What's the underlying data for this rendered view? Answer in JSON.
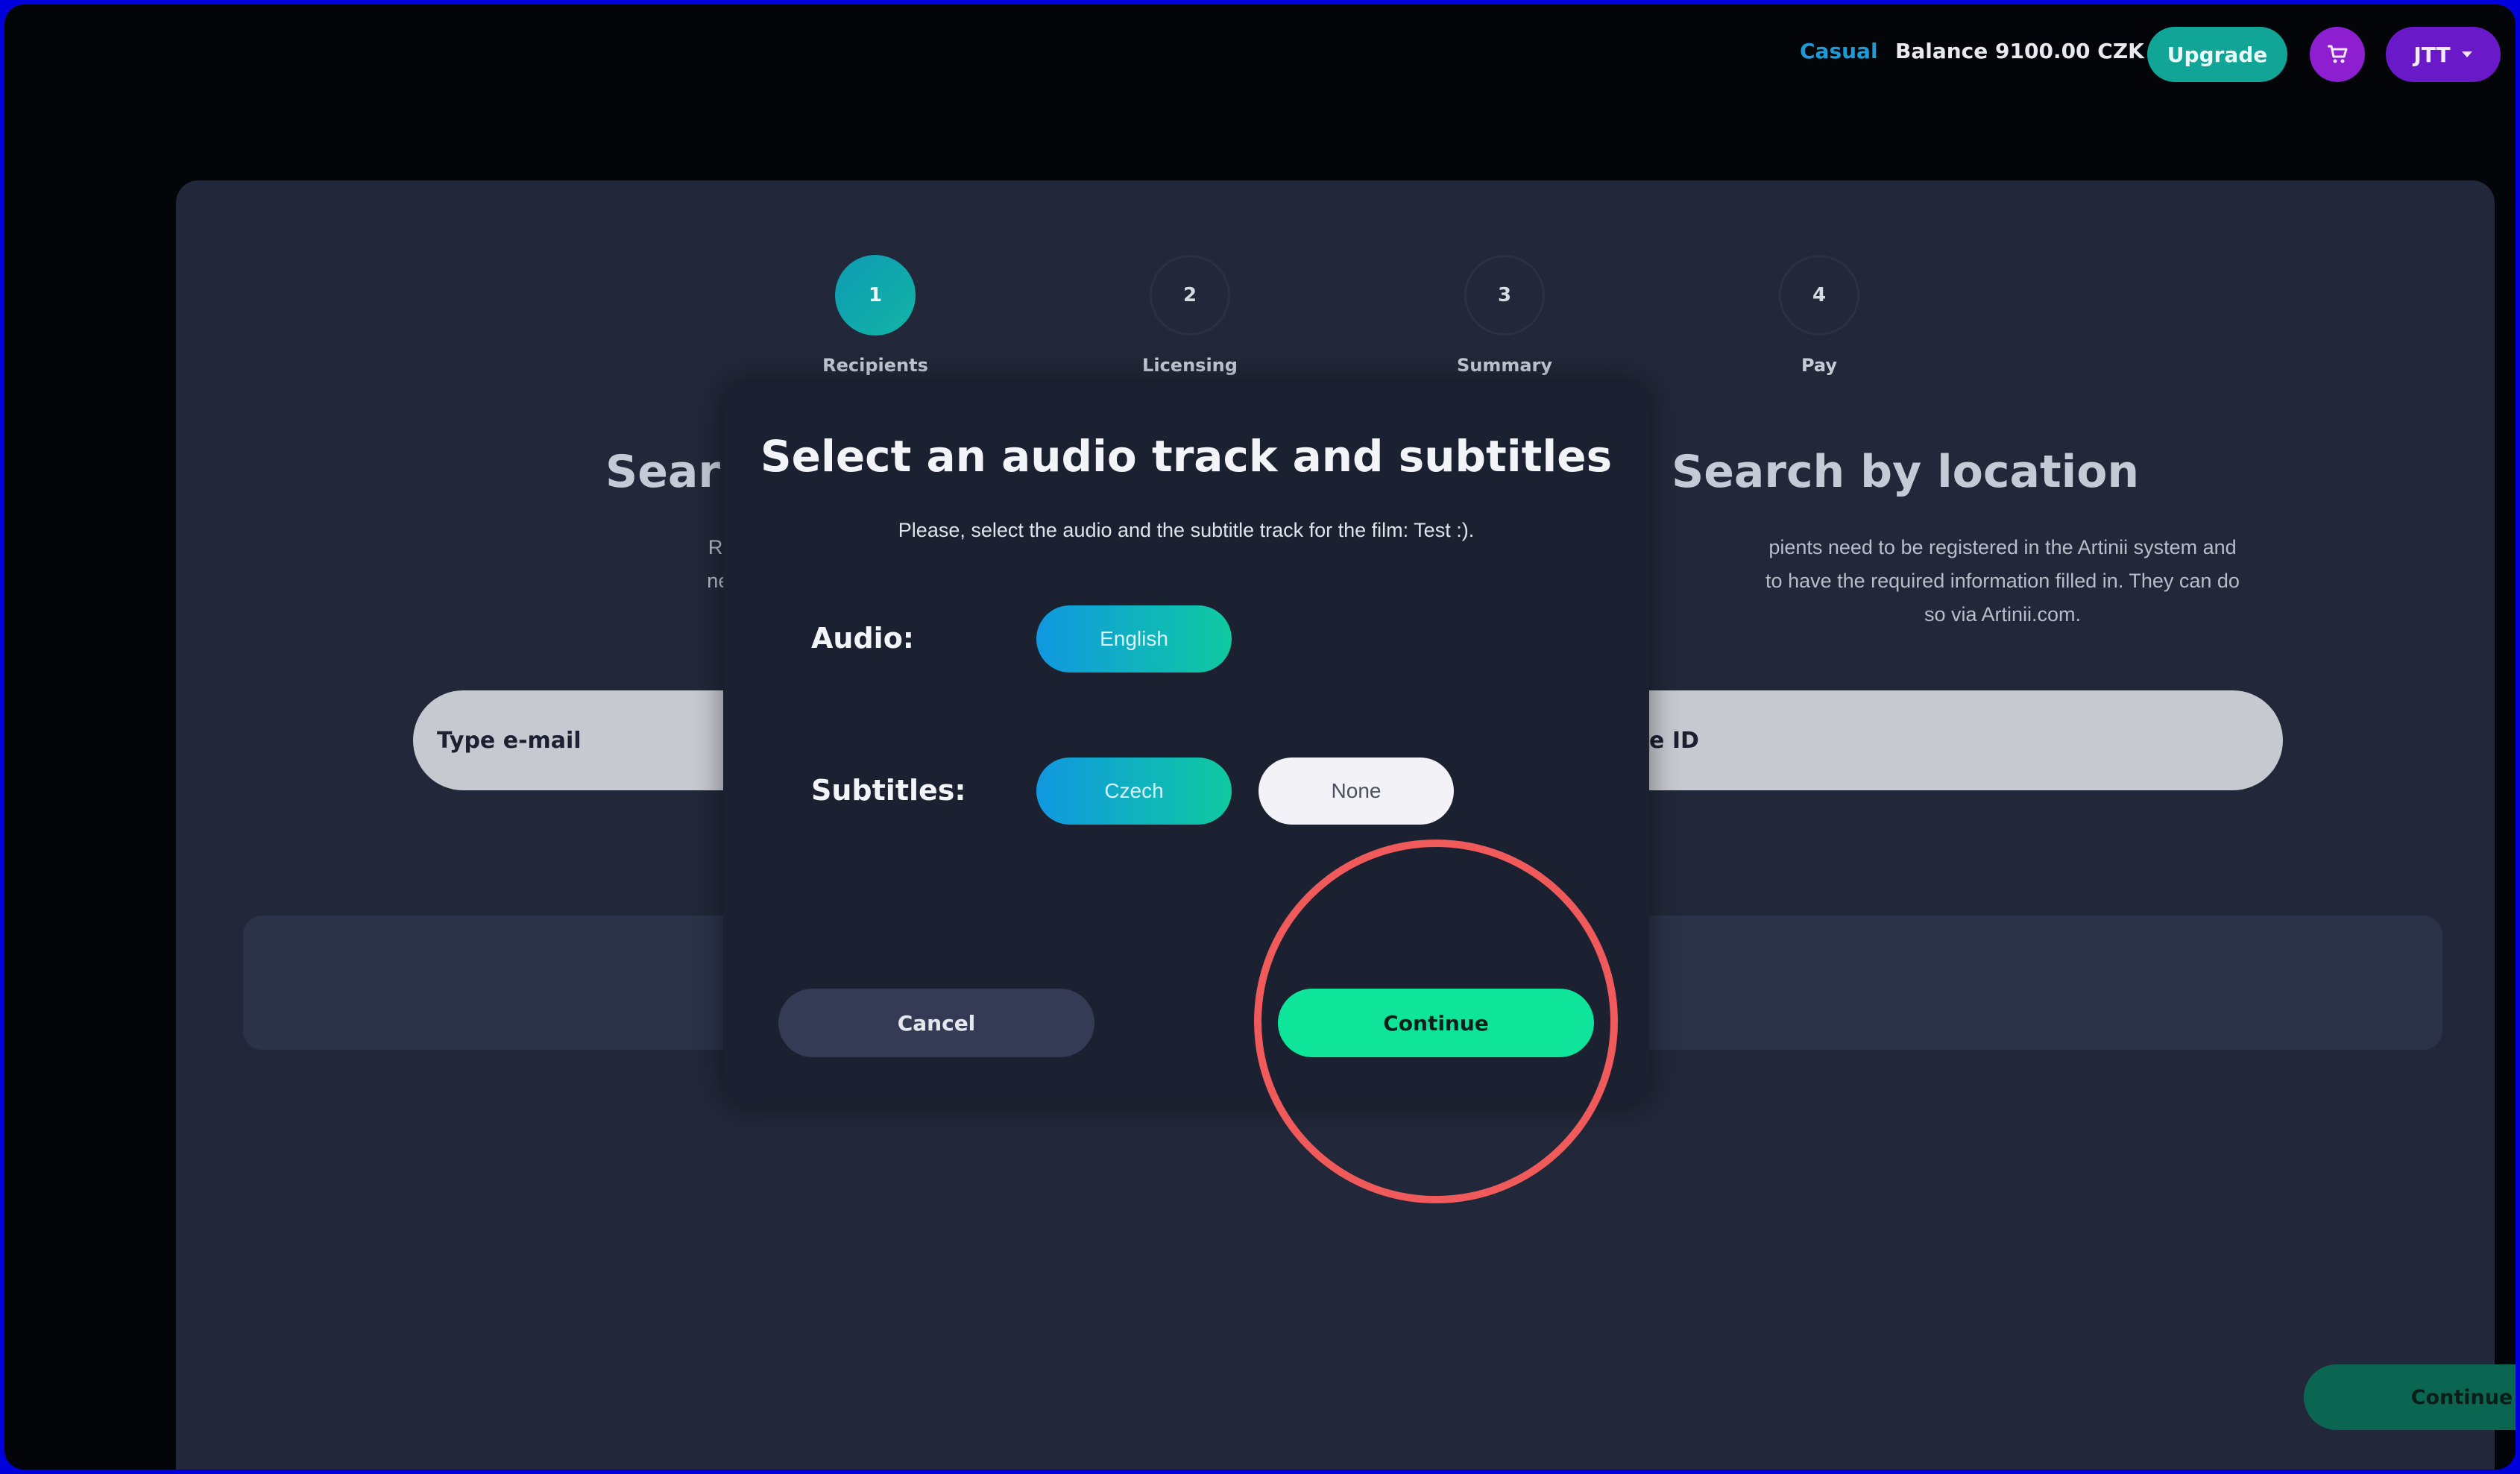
{
  "topbar": {
    "tier": "Casual",
    "balance": "Balance 9100.00 CZK",
    "upgrade_label": "Upgrade",
    "user_label": "JTT",
    "cart_icon": "cart-icon",
    "dropdown_icon": "caret-down-icon"
  },
  "steps": [
    {
      "number": "1",
      "label": "Recipients",
      "active": true
    },
    {
      "number": "2",
      "label": "Licensing",
      "active": false
    },
    {
      "number": "3",
      "label": "Summary",
      "active": false
    },
    {
      "number": "4",
      "label": "Pay",
      "active": false
    }
  ],
  "left_section": {
    "title": "Sear",
    "line1": "Recipients need to b",
    "line2": "need to have the req",
    "input_value": "Type e-mail"
  },
  "right_section": {
    "title": "Search by location",
    "line1": "pients need to be registered in the Artinii system and",
    "line2": "to have the required information filled in. They can do",
    "line3": "so via Artinii.com.",
    "input_value": "r place ID"
  },
  "background_continue_label": "Continue",
  "modal": {
    "title": "Select an audio track and subtitles",
    "description": "Please, select the audio and the subtitle track for the film: Test :).",
    "audio_label": "Audio:",
    "audio_options": [
      "English"
    ],
    "subtitles_label": "Subtitles:",
    "subtitle_options": [
      "Czech",
      "None"
    ],
    "cancel_label": "Cancel",
    "continue_label": "Continue"
  },
  "colors": {
    "accent_teal": "#10a596",
    "accent_green": "#0ee59a",
    "accent_purple": "#8e1fd0",
    "highlight_red": "#f05a5b",
    "frame_blue": "#0000dd"
  }
}
